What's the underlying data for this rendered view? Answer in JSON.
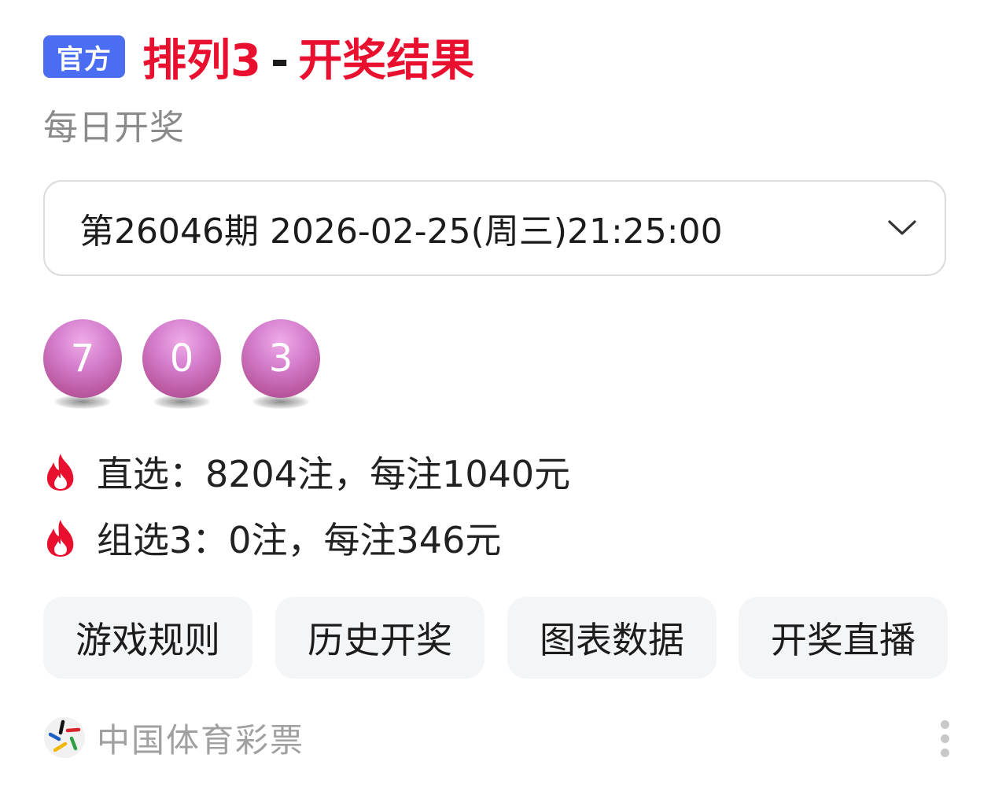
{
  "header": {
    "badge": "官方",
    "title_part1": "排列3",
    "separator": "-",
    "title_part2": "开奖结果",
    "subtitle": "每日开奖"
  },
  "draw_select": {
    "value": "第26046期 2026-02-25(周三)21:25:00",
    "icon": "chevron-down-icon"
  },
  "numbers": [
    "7",
    "0",
    "3"
  ],
  "prizes": [
    {
      "icon": "fire-icon",
      "text": "直选：8204注，每注1040元"
    },
    {
      "icon": "fire-icon",
      "text": "组选3：0注，每注346元"
    }
  ],
  "actions": [
    {
      "label": "游戏规则"
    },
    {
      "label": "历史开奖"
    },
    {
      "label": "图表数据"
    },
    {
      "label": "开奖直播"
    }
  ],
  "footer": {
    "logo": "china-sports-lottery-logo",
    "source": "中国体育彩票",
    "menu_icon": "more-vertical-icon"
  },
  "colors": {
    "title_red": "#e8102e",
    "badge_blue": "#4a6df2",
    "ball_purple": "#c46ab5",
    "fire_red": "#e8102e"
  }
}
